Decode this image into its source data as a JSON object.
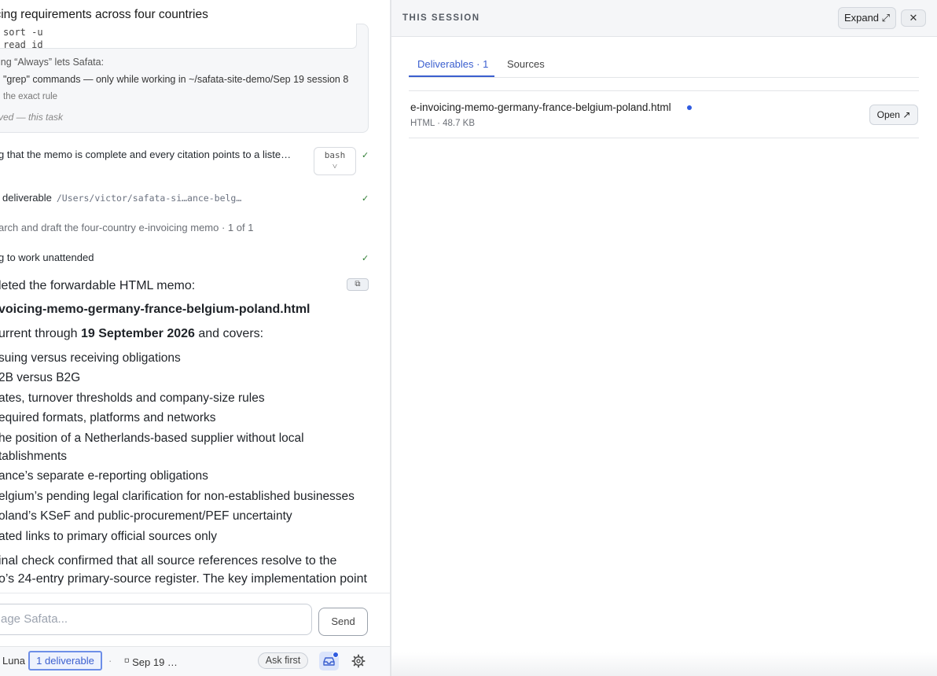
{
  "thread": {
    "title": "icing requirements across four countries"
  },
  "permission": {
    "code_lines": [
      "sort -u",
      "read id"
    ],
    "intro": "ing “Always” lets Safata:",
    "rule": "\"grep\" commands — only while working in ~/safata-site-demo/Sep 19 session 8",
    "exact_rule": "the exact rule",
    "scope": "ved — this task"
  },
  "steps": [
    {
      "label": "g that the memo is complete and every citation points to a liste…",
      "tool": "bash",
      "tool_chevron": "˅",
      "status": "✓"
    },
    {
      "label": "deliverable",
      "path": "/Users/victor/safata-si…ance-belg…",
      "status": "✓"
    },
    {
      "label": "arch and draft the four-country e-invoicing memo · 1 of 1"
    },
    {
      "label": "g to work unattended",
      "status": "✓"
    }
  ],
  "reply": {
    "intro": "leted the forwardable HTML memo:",
    "open_icon": "⧉",
    "filename": "voicing-memo-germany-france-belgium-poland.html",
    "current_prefix": "urrent through ",
    "current_date": "19 September 2026",
    "current_suffix": " and covers:",
    "bullets": [
      "suing versus receiving obligations",
      "2B versus B2G",
      "ates, turnover thresholds and company-size rules",
      "equired formats, platforms and networks",
      "he position of a Netherlands-based supplier without local",
      "tablishments",
      "ance’s separate e-reporting obligations",
      "elgium’s pending legal clarification for non-established businesses",
      "oland’s KSeF and public-procurement/PEF uncertainty",
      "ated links to primary official sources only"
    ],
    "final_line1": "inal check confirmed that all source references resolve to the",
    "final_line2": "o’s 24-entry primary-source register. The key implementation point"
  },
  "composer": {
    "placeholder": "age Safata...",
    "send_label": "Send"
  },
  "statusbar": {
    "model": "Luna",
    "separator": "·",
    "deliverables": "1 deliverable",
    "session": "⸋ Sep 19 …",
    "ask_first": "Ask first"
  },
  "session_panel": {
    "title": "THIS SESSION",
    "expand_label": "Expand ⤢",
    "close_label": "✕",
    "tabs": [
      {
        "label": "Deliverables · 1",
        "active": true
      },
      {
        "label": "Sources",
        "active": false
      }
    ],
    "files": [
      {
        "name": "e-invoicing-memo-germany-france-belgium-poland.html",
        "meta": "HTML · 48.7 KB",
        "open_label": "Open ↗"
      }
    ]
  },
  "colors": {
    "accent": "#3b5fcf",
    "check": "#2e7d32",
    "unread_dot": "#2f5be0"
  }
}
